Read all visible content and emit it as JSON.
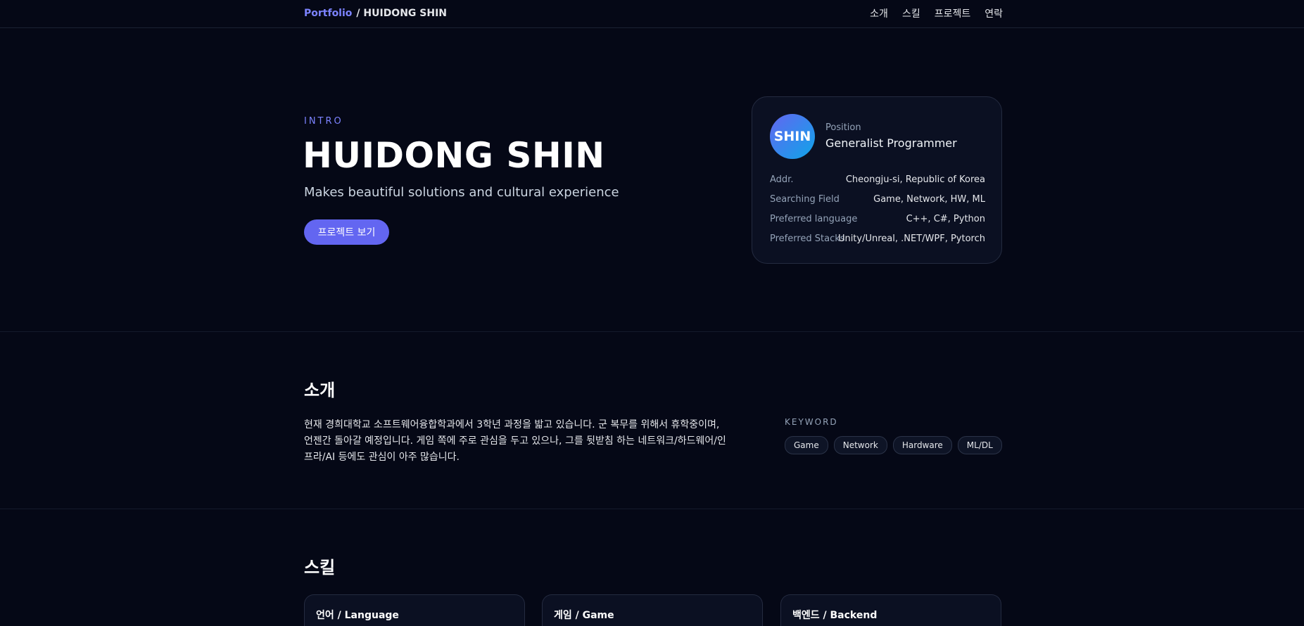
{
  "header": {
    "brand": "Portfolio",
    "brand_sep": "/ HUIDONG SHIN",
    "nav": [
      "소개",
      "스킬",
      "프로젝트",
      "연락"
    ]
  },
  "hero": {
    "label": "INTRO",
    "title": "HUIDONG SHIN",
    "subtitle": "Makes beautiful solutions and cultural experience",
    "cta": "프로젝트 보기"
  },
  "profile": {
    "avatar_text": "SHIN",
    "position_label": "Position",
    "position_value": "Generalist Programmer",
    "rows": [
      {
        "key": "Addr.",
        "value": "Cheongju-si, Republic of Korea"
      },
      {
        "key": "Searching Field",
        "value": "Game, Network, HW, ML"
      },
      {
        "key": "Preferred language",
        "value": "C++, C#, Python"
      },
      {
        "key": "Preferred Stacks",
        "value": "Unity/Unreal, .NET/WPF, Pytorch"
      }
    ]
  },
  "about": {
    "title": "소개",
    "lines": [
      "현재 경희대학교 소프트웨어융합학과에서 3학년 과정을 밟고 있습니다. 군 복무를 위해서 휴학중이며,",
      "언젠간 돌아갈 예정입니다. 게임 쪽에 주로 관심을 두고 있으나, 그를 뒷받침 하는 네트워크/하드웨어/인",
      "프라/AI 등에도 관심이 아주 많습니다."
    ],
    "keyword_label": "KEYWORD",
    "keywords": [
      "Game",
      "Network",
      "Hardware",
      "ML/DL"
    ]
  },
  "skills": {
    "title": "스킬",
    "cards": [
      "언어 / Language",
      "게임 / Game",
      "백엔드 / Backend"
    ]
  },
  "colors": {
    "background": "#050816",
    "accent": "#6366f1",
    "accent_text": "#7c83ff"
  }
}
